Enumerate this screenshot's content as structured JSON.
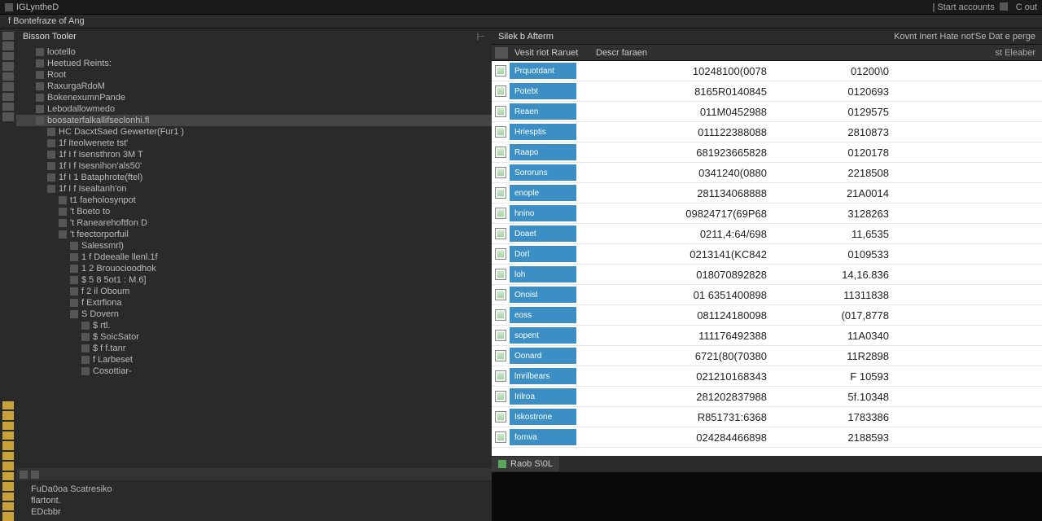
{
  "titlebar": {
    "app_name": "IGLyntheD",
    "right_hint": "| Start accounts",
    "quick": "C  out"
  },
  "menubar": {
    "label": "f Bontefraze of Ang"
  },
  "tree": {
    "head_title": "Bisson Tooler",
    "items": [
      {
        "label": "lootello",
        "indent": 1
      },
      {
        "label": "Heetued Reints:",
        "indent": 1
      },
      {
        "label": "Root",
        "indent": 1
      },
      {
        "label": "RaxurgaRdoM",
        "indent": 1
      },
      {
        "label": "BokenexumnPande",
        "indent": 1
      },
      {
        "label": "Lebodallowmedo",
        "indent": 1
      },
      {
        "label": "boosaterfalkallifseclonhi.fl",
        "indent": 1,
        "selected": true
      },
      {
        "label": "HC DacxtSaed Gewerter(Fur1 )",
        "indent": 2
      },
      {
        "label": "1f Iteolwenete tst'",
        "indent": 2
      },
      {
        "label": "1f I f Isensthron 3M T",
        "indent": 2
      },
      {
        "label": "1f I f Isesnihon'als50'",
        "indent": 2
      },
      {
        "label": "1f I 1 Bataphrote(ftel)",
        "indent": 2
      },
      {
        "label": "1f I f Isealtanh'on",
        "indent": 2
      },
      {
        "label": "t1 faeholosynpot",
        "indent": 3
      },
      {
        "label": "'t Boeto to",
        "indent": 3
      },
      {
        "label": "'t Ranearehoftfon D",
        "indent": 3
      },
      {
        "label": "'t feectorporfuil",
        "indent": 3
      },
      {
        "label": "Salessmrl)",
        "indent": 4
      },
      {
        "label": "1 f Ddeealle llenl.1f",
        "indent": 4
      },
      {
        "label": "1 2 Brouocioodhok",
        "indent": 4
      },
      {
        "label": "$ 5 8 5ot1 : M.6]",
        "indent": 4
      },
      {
        "label": "f 2 il Oboum",
        "indent": 4
      },
      {
        "label": "f Extrfiona",
        "indent": 4
      },
      {
        "label": "S Dovern",
        "indent": 4
      },
      {
        "label": "$ rtl.",
        "indent": 5
      },
      {
        "label": "$ SoicSator",
        "indent": 5
      },
      {
        "label": "$ f f.tanr",
        "indent": 5
      },
      {
        "label": "f Larbeset",
        "indent": 5
      },
      {
        "label": "Cosottiar-",
        "indent": 5
      }
    ],
    "bottom_items": [
      "FuDa0oa Scatresiko",
      "flartont.",
      "EDcbbr"
    ]
  },
  "right": {
    "title_left": "Silek b Afterm",
    "title_right": "Kovnt Inert Hate not'Se Dat e perge",
    "col_name": "Vesit riot Raruet",
    "col_desc": "Descr faraen",
    "col_right": "st Eleaber",
    "rows": [
      {
        "name": "Prquotdant",
        "v1": "10248100(0078",
        "v2": "01200\\0"
      },
      {
        "name": "Potebt",
        "v1": "8165R0140845",
        "v2": "0120693"
      },
      {
        "name": "Reaen",
        "v1": "011M0452988",
        "v2": "0129575"
      },
      {
        "name": "Hriesptis",
        "v1": "011122388088",
        "v2": "2810873"
      },
      {
        "name": "Raapo",
        "v1": "681923665828",
        "v2": "0120178"
      },
      {
        "name": "Sororuns",
        "v1": "0341240(0880",
        "v2": "2218508"
      },
      {
        "name": "enople",
        "v1": "281134068888",
        "v2": "21A0014"
      },
      {
        "name": "hnino",
        "v1": "09824717(69P68",
        "v2": "3128263"
      },
      {
        "name": "Doaet",
        "v1": "0211,4:64/698",
        "v2": "11,6535"
      },
      {
        "name": "Dorl",
        "v1": "0213141(KC842",
        "v2": "0109533"
      },
      {
        "name": "loh",
        "v1": "018070892828",
        "v2": "14,16.836"
      },
      {
        "name": "Onoisl",
        "v1": "01 6351400898",
        "v2": "11311838"
      },
      {
        "name": "eoss",
        "v1": "081124180098",
        "v2": "(017,8778"
      },
      {
        "name": "sopent",
        "v1": "111176492388",
        "v2": "11A0340"
      },
      {
        "name": "Oonard",
        "v1": "6721(80(70380",
        "v2": "11R2898"
      },
      {
        "name": "lmrilbears",
        "v1": "021210168343",
        "v2": "F 10593"
      },
      {
        "name": "Irilroa",
        "v1": "281202837988",
        "v2": "5f.10348"
      },
      {
        "name": "Iskostrone",
        "v1": "R851731:6368",
        "v2": "1783386"
      },
      {
        "name": "fornva",
        "v1": "024284466898",
        "v2": "2188593"
      }
    ],
    "tab_label": "Raob S\\0L"
  }
}
